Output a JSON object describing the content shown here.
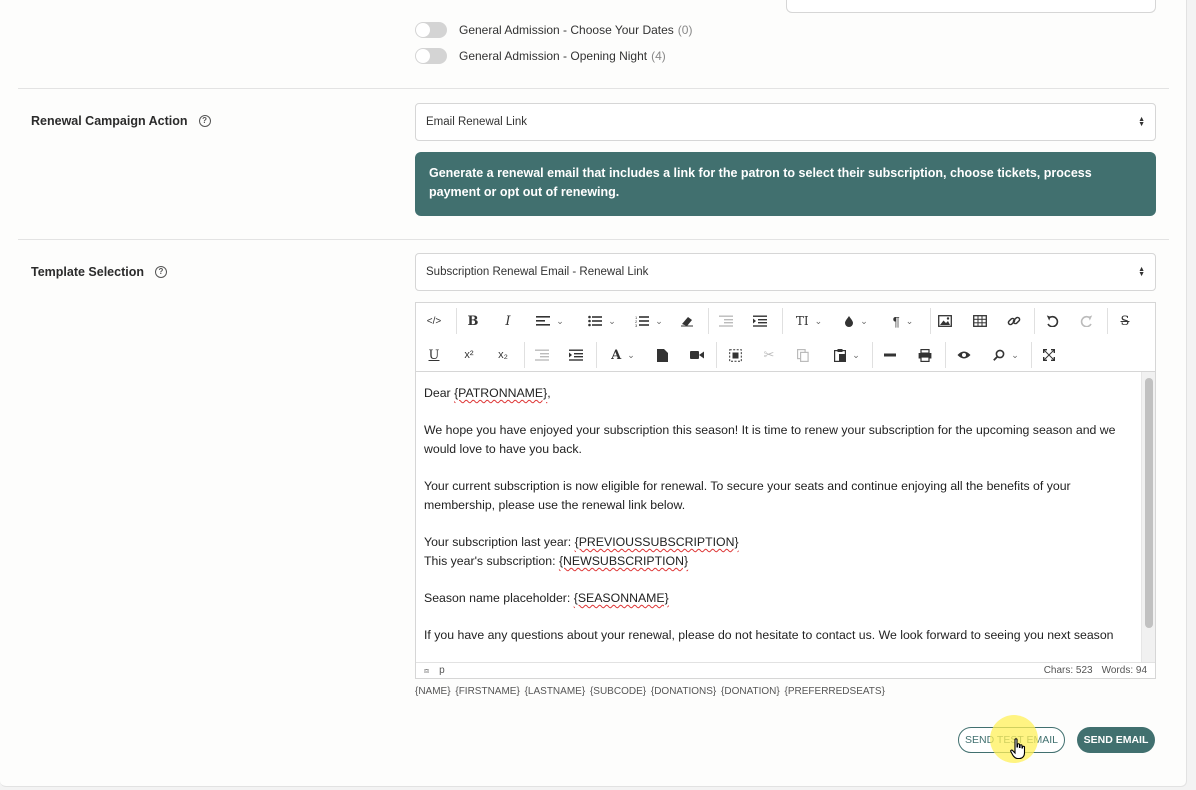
{
  "ticket_toggles": [
    {
      "label": "General Admission - Choose Your Dates",
      "count": "(0)"
    },
    {
      "label": "General Admission - Opening Night",
      "count": "(4)"
    }
  ],
  "renewal": {
    "label": "Renewal Campaign Action",
    "selected": "Email Renewal Link",
    "info": "Generate a renewal email that includes a link for the patron to select their subscription, choose tickets, process payment or opt out of renewing."
  },
  "template": {
    "label": "Template Selection",
    "selected": "Subscription Renewal Email - Renewal Link"
  },
  "toolbar_icons": {
    "code": "</>",
    "bold": "B",
    "italic": "I",
    "font_size": "TI",
    "underline": "U",
    "superscript": "x²",
    "subscript": "x₂",
    "pilcrow": "¶",
    "font_color": "A"
  },
  "email_body": {
    "greeting_prefix": "Dear ",
    "greeting_placeholder": "{PATRONNAME}",
    "greeting_suffix": ",",
    "para1": "We hope you have enjoyed your subscription this season! It is time to renew your subscription for the upcoming season and we would love to have you back.",
    "para2": "Your current subscription is now eligible for renewal. To secure your seats and continue enjoying all the benefits of your membership, please use the renewal link below.",
    "last_year_prefix": "Your subscription last year: ",
    "last_year_placeholder": "{PREVIOUSSUBSCRIPTION}",
    "this_year_prefix": "This year's subscription: ",
    "this_year_placeholder": "{NEWSUBSCRIPTION}",
    "season_prefix": "Season name placeholder: ",
    "season_placeholder": "{SEASONNAME}",
    "para_last": "If you have any questions about your renewal, please do not hesitate to contact us. We look forward to seeing you next season"
  },
  "statusbar": {
    "path": "p",
    "chars": "Chars: 523",
    "words": "Words: 94"
  },
  "placeholder_tags": "{NAME}  {FIRSTNAME} {LASTNAME} {SUBCODE}  {DONATIONS}  {DONATION}  {PREFERREDSEATS}",
  "buttons": {
    "send_test": "SEND TEST EMAIL",
    "send": "SEND EMAIL"
  },
  "colors": {
    "accent": "#41706f",
    "toggle_off": "#d4d4d4",
    "cursor_highlight": "#fff05a"
  }
}
